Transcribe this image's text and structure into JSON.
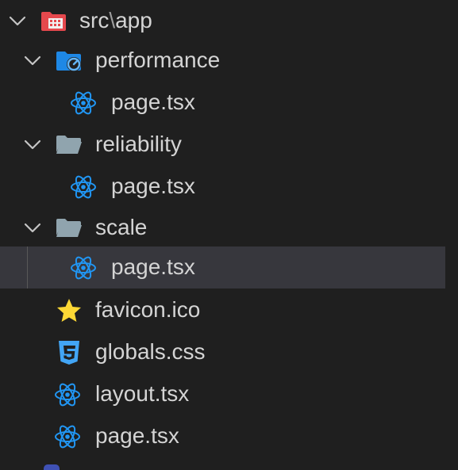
{
  "explorer": {
    "root": {
      "label_src": "src",
      "separator": "\\",
      "label_app": "app",
      "icon": "app-folder-icon",
      "expanded": true
    },
    "folders": [
      {
        "label": "performance",
        "icon": "performance-folder-icon",
        "expanded": true
      },
      {
        "label": "reliability",
        "icon": "folder-open-icon",
        "expanded": true
      },
      {
        "label": "scale",
        "icon": "folder-open-icon",
        "expanded": true
      }
    ],
    "files": [
      {
        "label": "page.tsx",
        "icon": "react-icon"
      },
      {
        "label": "page.tsx",
        "icon": "react-icon"
      },
      {
        "label": "page.tsx",
        "icon": "react-icon",
        "selected": true
      },
      {
        "label": "favicon.ico",
        "icon": "star-icon"
      },
      {
        "label": "globals.css",
        "icon": "css-icon"
      },
      {
        "label": "layout.tsx",
        "icon": "react-icon"
      },
      {
        "label": "page.tsx",
        "icon": "react-icon"
      }
    ]
  },
  "colors": {
    "background": "#1f1f1f",
    "selected_row": "#37373d",
    "text": "#d4d4d4",
    "app_folder": "#e5484d",
    "react": "#2196f3",
    "css": "#42a5f5",
    "star": "#fdd835",
    "folder": "#90a4ae"
  }
}
